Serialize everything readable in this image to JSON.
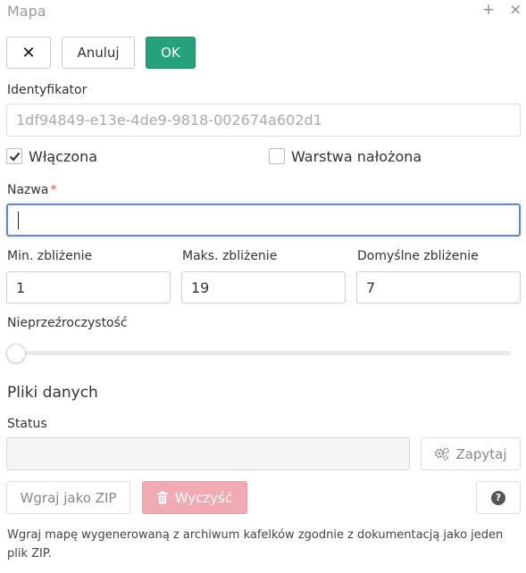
{
  "window": {
    "title": "Mapa",
    "plus_glyph": "+",
    "close_glyph": "×"
  },
  "toolbar": {
    "close_glyph": "✕",
    "cancel_label": "Anuluj",
    "ok_label": "OK",
    "ok_color": "#26a17b"
  },
  "identifier": {
    "label": "Identyfikator",
    "value": "1df94849-e13e-4de9-9818-002674a602d1"
  },
  "checkboxes": {
    "enabled": {
      "label": "Włączona",
      "checked": true
    },
    "overlay": {
      "label": "Warstwa nałożona",
      "checked": false
    }
  },
  "name": {
    "label": "Nazwa",
    "required_mark": "*",
    "value": ""
  },
  "zoom": {
    "min": {
      "label": "Min. zbliżenie",
      "value": "1"
    },
    "max": {
      "label": "Maks. zbliżenie",
      "value": "19"
    },
    "default": {
      "label": "Domyślne zbliżenie",
      "value": "7"
    }
  },
  "opacity": {
    "label": "Nieprzeźroczystość",
    "value": 0
  },
  "data_files": {
    "heading": "Pliki danych",
    "status_label": "Status",
    "status_value": "",
    "query_label": "Zapytaj",
    "upload_zip_label": "Wgraj jako ZIP",
    "clear_label": "Wyczyść",
    "help_glyph": "?",
    "help_text": "Wgraj mapę wygenerowaną z archiwum kafelków zgodnie z dokumentacją jako jeden plik ZIP."
  },
  "icons": {
    "gears": "gears-icon",
    "trash": "trash-icon",
    "question": "question-icon",
    "check": "check-icon"
  }
}
